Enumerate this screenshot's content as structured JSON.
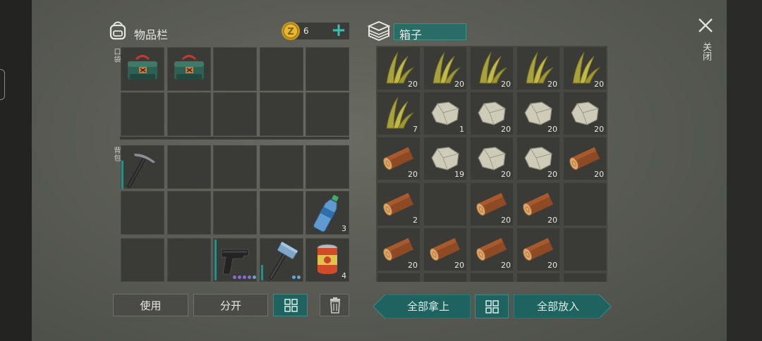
{
  "inventory": {
    "title": "物品栏",
    "coin_count": "6",
    "pocket_label": "口袋",
    "backpack_label": "背包",
    "pocket_items": [
      {
        "name": "toolbox-icon",
        "count": ""
      },
      {
        "name": "toolbox-icon",
        "count": ""
      }
    ],
    "backpack_items": [
      {
        "name": "pickaxe-icon",
        "count": ""
      },
      {
        "name": "water-bottle-icon",
        "count": "3"
      },
      {
        "name": "pistol-icon",
        "count": ""
      },
      {
        "name": "hammer-icon",
        "count": ""
      },
      {
        "name": "canned-food-icon",
        "count": "4"
      }
    ]
  },
  "chest": {
    "title": "箱子",
    "rows": [
      [
        {
          "item": "grass",
          "count": "20"
        },
        {
          "item": "grass",
          "count": "20"
        },
        {
          "item": "grass",
          "count": "20"
        },
        {
          "item": "grass",
          "count": "20"
        },
        {
          "item": "grass",
          "count": "20"
        }
      ],
      [
        {
          "item": "grass",
          "count": "7"
        },
        {
          "item": "stone",
          "count": "1"
        },
        {
          "item": "stone",
          "count": "20"
        },
        {
          "item": "stone",
          "count": "20"
        },
        {
          "item": "stone",
          "count": "20"
        }
      ],
      [
        {
          "item": "log",
          "count": "20"
        },
        {
          "item": "stone",
          "count": "19"
        },
        {
          "item": "stone",
          "count": "20"
        },
        {
          "item": "stone",
          "count": "20"
        },
        {
          "item": "log",
          "count": "20"
        }
      ],
      [
        {
          "item": "log",
          "count": "2"
        },
        {
          "item": "",
          "count": ""
        },
        {
          "item": "log",
          "count": "20"
        },
        {
          "item": "log",
          "count": "20"
        },
        {
          "item": "",
          "count": ""
        }
      ],
      [
        {
          "item": "log",
          "count": "20"
        },
        {
          "item": "log",
          "count": "20"
        },
        {
          "item": "log",
          "count": "20"
        },
        {
          "item": "log",
          "count": "20"
        },
        {
          "item": "",
          "count": ""
        }
      ]
    ]
  },
  "buttons": {
    "use": "使用",
    "split": "分开",
    "take_all": "全部拿上",
    "put_all": "全部放入"
  },
  "close_label": "关闭",
  "colors": {
    "accent": "#1f6360",
    "slot": "#3a3b37",
    "panel": "#5a5c55"
  }
}
